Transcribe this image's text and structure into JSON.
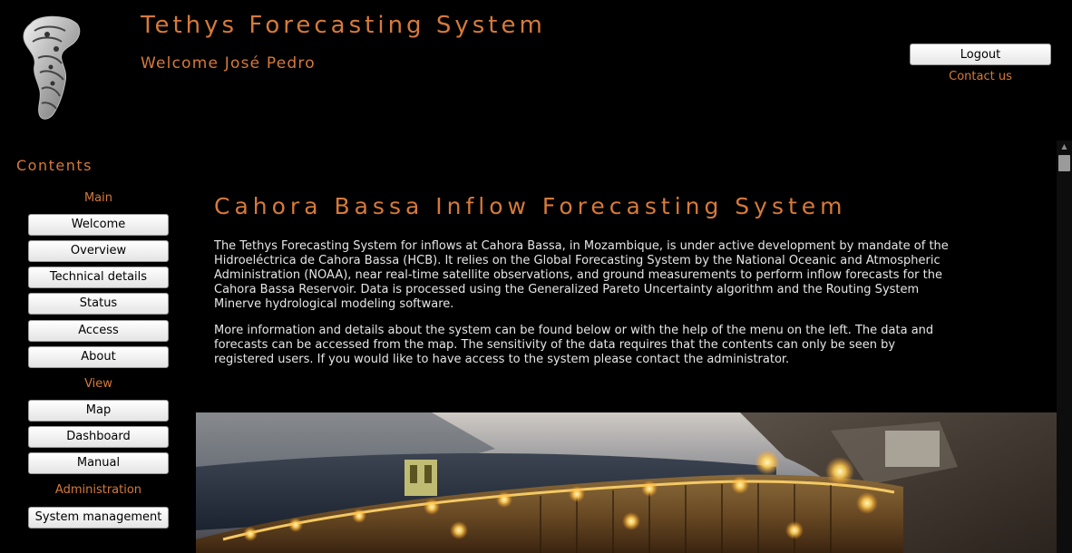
{
  "header": {
    "title": "Tethys Forecasting System",
    "welcome": "Welcome José Pedro",
    "logout_label": "Logout",
    "contact_label": "Contact us"
  },
  "sidebar": {
    "title": "Contents",
    "groups": [
      {
        "label": "Main",
        "items": [
          "Welcome",
          "Overview",
          "Technical details",
          "Status",
          "Access",
          "About"
        ]
      },
      {
        "label": "View",
        "items": [
          "Map",
          "Dashboard",
          "Manual"
        ]
      },
      {
        "label": "Administration",
        "items": [
          "System management"
        ]
      }
    ]
  },
  "main": {
    "title": "Cahora Bassa Inflow Forecasting System",
    "paragraph1": "The Tethys Forecasting System for inflows at Cahora Bassa, in Mozambique, is under active development by mandate of the Hidroeléctrica de Cahora Bassa (HCB). It relies on the Global Forecasting System by the National Oceanic and Atmospheric Administration (NOAA), near real-time satellite observations, and ground measurements to perform inflow forecasts for the Cahora Bassa Reservoir. Data is processed using the Generalized Pareto Uncertainty algorithm and the Routing System Minerve hydrological modeling software.",
    "paragraph2": "More information and details about the system can be found below or with the help of the menu on the left. The data and forecasts can be accessed from the map. The sensitivity of the data requires that the contents can only be seen by registered users. If you would like to have access to the system please contact the administrator."
  },
  "colors": {
    "accent": "#d67a3a",
    "background": "#000000",
    "text": "#e6e6e6"
  },
  "icons": {
    "logo": "tethys-logo-icon",
    "scroll_up": "scroll-up-arrow-icon"
  }
}
